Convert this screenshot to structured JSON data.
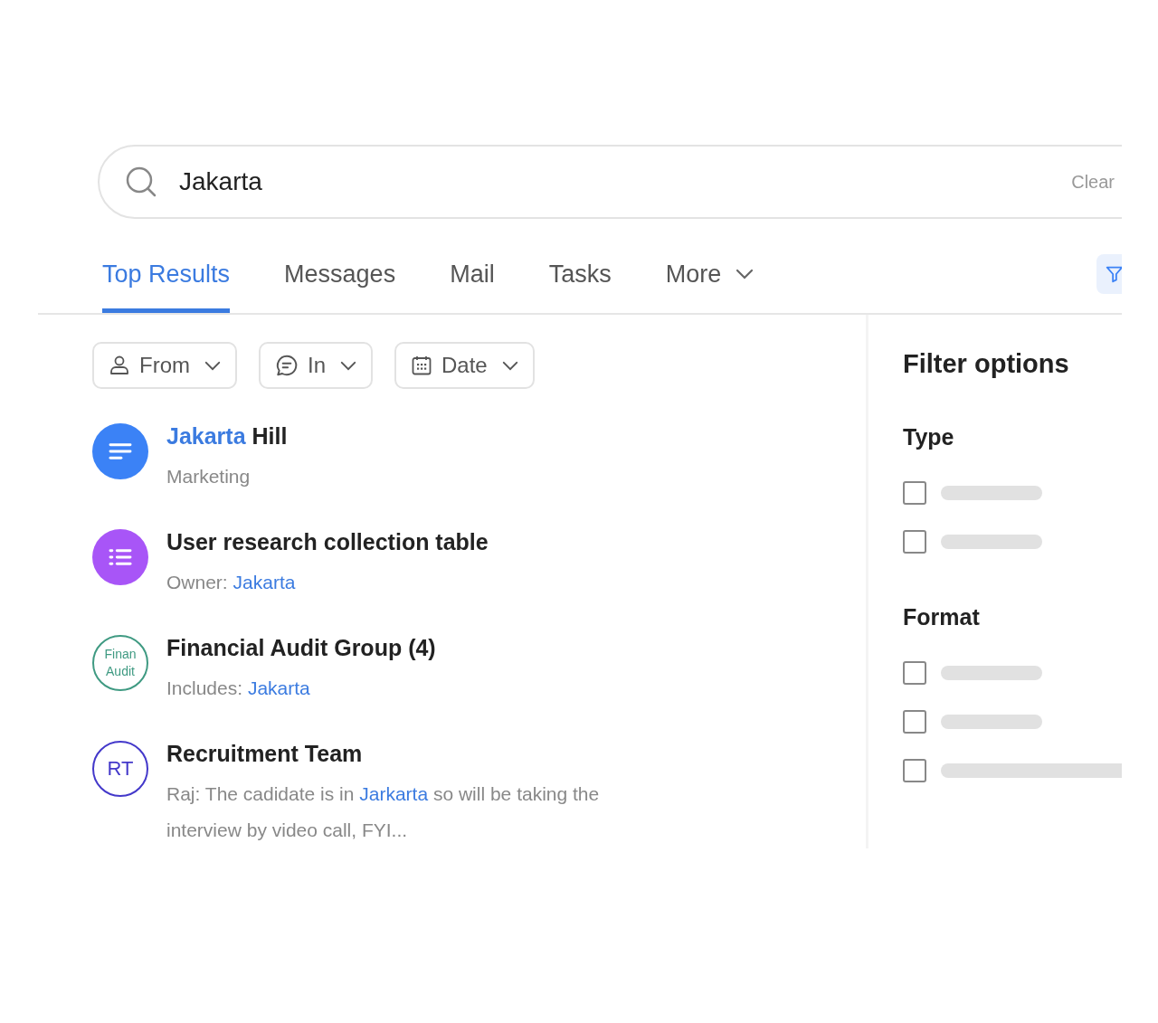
{
  "search": {
    "value": "Jakarta",
    "clear": "Clear"
  },
  "tabs": [
    {
      "label": "Top Results",
      "selected": true
    },
    {
      "label": "Messages",
      "selected": false
    },
    {
      "label": "Mail",
      "selected": false
    },
    {
      "label": "Tasks",
      "selected": false
    },
    {
      "label": "More",
      "selected": false,
      "dropdown": true
    }
  ],
  "filters": [
    {
      "kind": "person",
      "label": "From"
    },
    {
      "kind": "chat",
      "label": "In"
    },
    {
      "kind": "calendar",
      "label": "Date"
    }
  ],
  "results": [
    {
      "avatar": {
        "kind": "lines",
        "color": "#3b82f6"
      },
      "title": [
        {
          "text": "Jakarta",
          "highlight": true
        },
        {
          "text": " Hill",
          "highlight": false
        }
      ],
      "subtitle": [
        {
          "text": "Marketing",
          "highlight": false
        }
      ]
    },
    {
      "avatar": {
        "kind": "list",
        "color": "#a855f7"
      },
      "title": [
        {
          "text": "User research collection table",
          "highlight": false
        }
      ],
      "subtitle": [
        {
          "text": "Owner: ",
          "highlight": false
        },
        {
          "text": "Jakarta",
          "highlight": true
        }
      ]
    },
    {
      "avatar": {
        "kind": "initials",
        "color": "#3f9a82",
        "lines": [
          "Finan",
          "Audit"
        ]
      },
      "title": [
        {
          "text": "Financial Audit Group (4)",
          "highlight": false
        }
      ],
      "subtitle": [
        {
          "text": "Includes: ",
          "highlight": false
        },
        {
          "text": "Jakarta",
          "highlight": true
        }
      ]
    },
    {
      "avatar": {
        "kind": "initials",
        "color": "#4338ca",
        "lines": [
          "RT"
        ]
      },
      "title": [
        {
          "text": "Recruitment Team",
          "highlight": false
        }
      ],
      "subtitle": [
        {
          "text": "Raj: The cadidate is in ",
          "highlight": false
        },
        {
          "text": "Jarkarta",
          "highlight": true
        },
        {
          "text": " so will be taking the interview by video call, FYI...",
          "highlight": false
        }
      ]
    }
  ],
  "filter_panel": {
    "title": "Filter options",
    "groups": [
      {
        "title": "Type",
        "options": [
          {
            "checked": false,
            "wide": false
          },
          {
            "checked": false,
            "wide": false
          }
        ]
      },
      {
        "title": "Format",
        "options": [
          {
            "checked": false,
            "wide": false
          },
          {
            "checked": false,
            "wide": false
          },
          {
            "checked": false,
            "wide": true
          }
        ]
      }
    ]
  }
}
